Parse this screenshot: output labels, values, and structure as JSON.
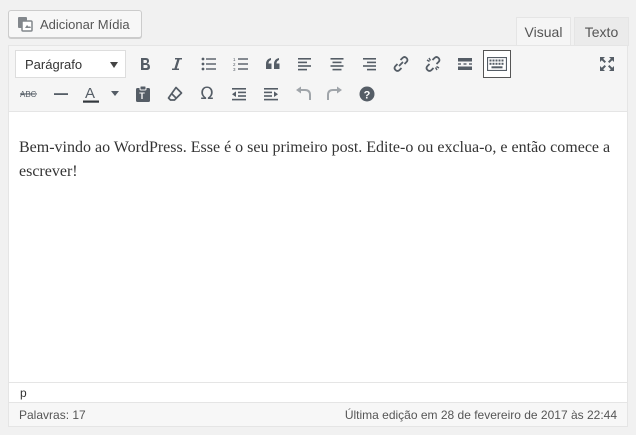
{
  "media_button": {
    "label": "Adicionar Mídia",
    "icon": "media-icon"
  },
  "tabs": [
    {
      "label": "Visual",
      "active": true
    },
    {
      "label": "Texto",
      "active": false
    }
  ],
  "toolbar": {
    "format_select": "Parágrafo",
    "row1": [
      "bold-icon",
      "italic-icon",
      "bullet-list-icon",
      "numbered-list-icon",
      "blockquote-icon",
      "align-left-icon",
      "align-center-icon",
      "align-right-icon",
      "link-icon",
      "unlink-icon",
      "read-more-icon",
      "toolbar-toggle-icon",
      "fullscreen-icon"
    ],
    "row2": [
      "strikethrough-icon",
      "horizontal-line-icon",
      "text-color-icon",
      "paste-text-icon",
      "clear-formatting-icon",
      "special-char-icon",
      "outdent-icon",
      "indent-icon",
      "undo-icon",
      "redo-icon",
      "help-icon"
    ],
    "strike_label": "ABC",
    "text_color_label": "A",
    "omega": "Ω",
    "help": "?"
  },
  "content": {
    "paragraph": "Bem-vindo ao WordPress. Esse é o seu primeiro post. Edite-o ou exclua-o, e então comece a escrever!"
  },
  "path": "p",
  "status": {
    "word_count": "Palavras: 17",
    "last_edit": "Última edição em 28 de fevereiro de 2017 às 22:44"
  },
  "colors": {
    "icon": "#555d66",
    "accent": "#32373c",
    "text_color_bar": "#32373c"
  }
}
